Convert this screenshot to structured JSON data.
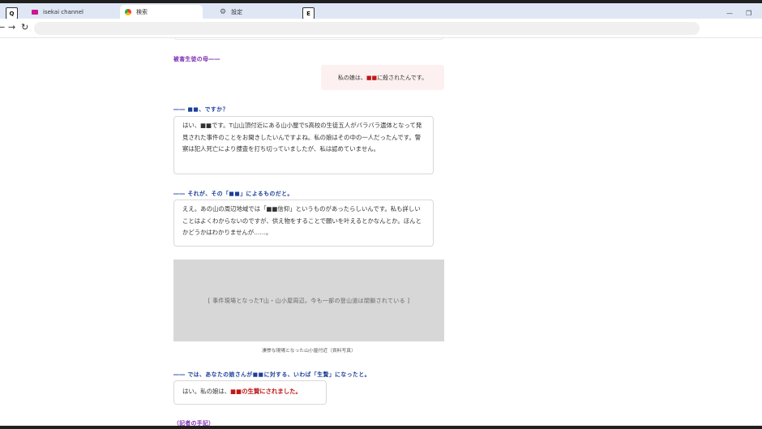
{
  "browser": {
    "tabs": [
      {
        "label": "isekai channel",
        "active": false
      },
      {
        "label": "検索",
        "active": true
      },
      {
        "label": "設定",
        "active": false
      }
    ],
    "key_badges": [
      "Q",
      "E"
    ],
    "nav": {
      "back": "←",
      "forward": "→",
      "reload": "↻"
    },
    "window_controls": {
      "minimize": "—",
      "restore": "❐"
    },
    "address": ""
  },
  "article": {
    "speaker_label": "被害生徒の母――",
    "mother_quote": {
      "before": "私の娘は、",
      "redacted": "■■",
      "after": "に殺されたんです。"
    },
    "q1": "―― ■■、ですか？",
    "a1": "はい、■■です。T山山頂付近にある山小屋でS高校の生徒五人がバラバラ遺体となって発見された事件のことをお聞きしたいんですよね。私の娘はその中の一人だったんです。警察は犯人死亡により捜査を打ち切っていましたが、私は認めていません。",
    "q2": "―― それが、その「■■」によるものだと。",
    "a2": "ええ。あの山の周辺地域では「■■信仰」というものがあったらしいんです。私も詳しいことはよくわからないのですが、供え物をすることで願いを叶えるとかなんとか。ほんとかどうかはわかりませんが……。",
    "photo_text": "[ 事件現場となったT山・山小屋周辺。今も一部の登山道は閉鎖されている ]",
    "photo_caption": "凄惨な現場となった山小屋付近（資料写真）",
    "q3": "―― では、あなたの娘さんが■■に対する、いわば「生贄」になったと。",
    "a3": {
      "before": "はい。私の娘は、",
      "redacted": "■■の生贄にされました。"
    },
    "footer_label": "（記者の手記）"
  },
  "colors": {
    "accent_question": "#1c3f9a",
    "accent_speaker": "#7a2ab0",
    "redacted": "#c01818",
    "quote_bg": "#fdf0f0"
  }
}
